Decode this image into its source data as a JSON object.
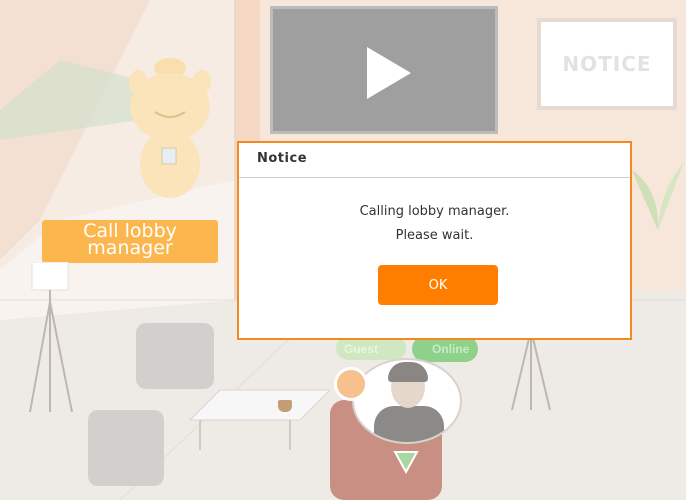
{
  "scene": {
    "notice_board_text": "NOTICE",
    "call_button_label": "Call lobby manager",
    "guest_label": "Guest",
    "online_label": "Online",
    "icons": [
      "play-icon",
      "mascot-icon",
      "chat-icon",
      "location-marker-icon"
    ]
  },
  "dialog": {
    "title": "Notice",
    "message_line1": "Calling lobby manager.",
    "message_line2": "Please wait.",
    "ok_label": "OK"
  },
  "colors": {
    "accent": "#ff7e00",
    "dialog_border": "#f28a1f",
    "call_button": "#fbb64e",
    "online_badge": "#8fd18a"
  }
}
